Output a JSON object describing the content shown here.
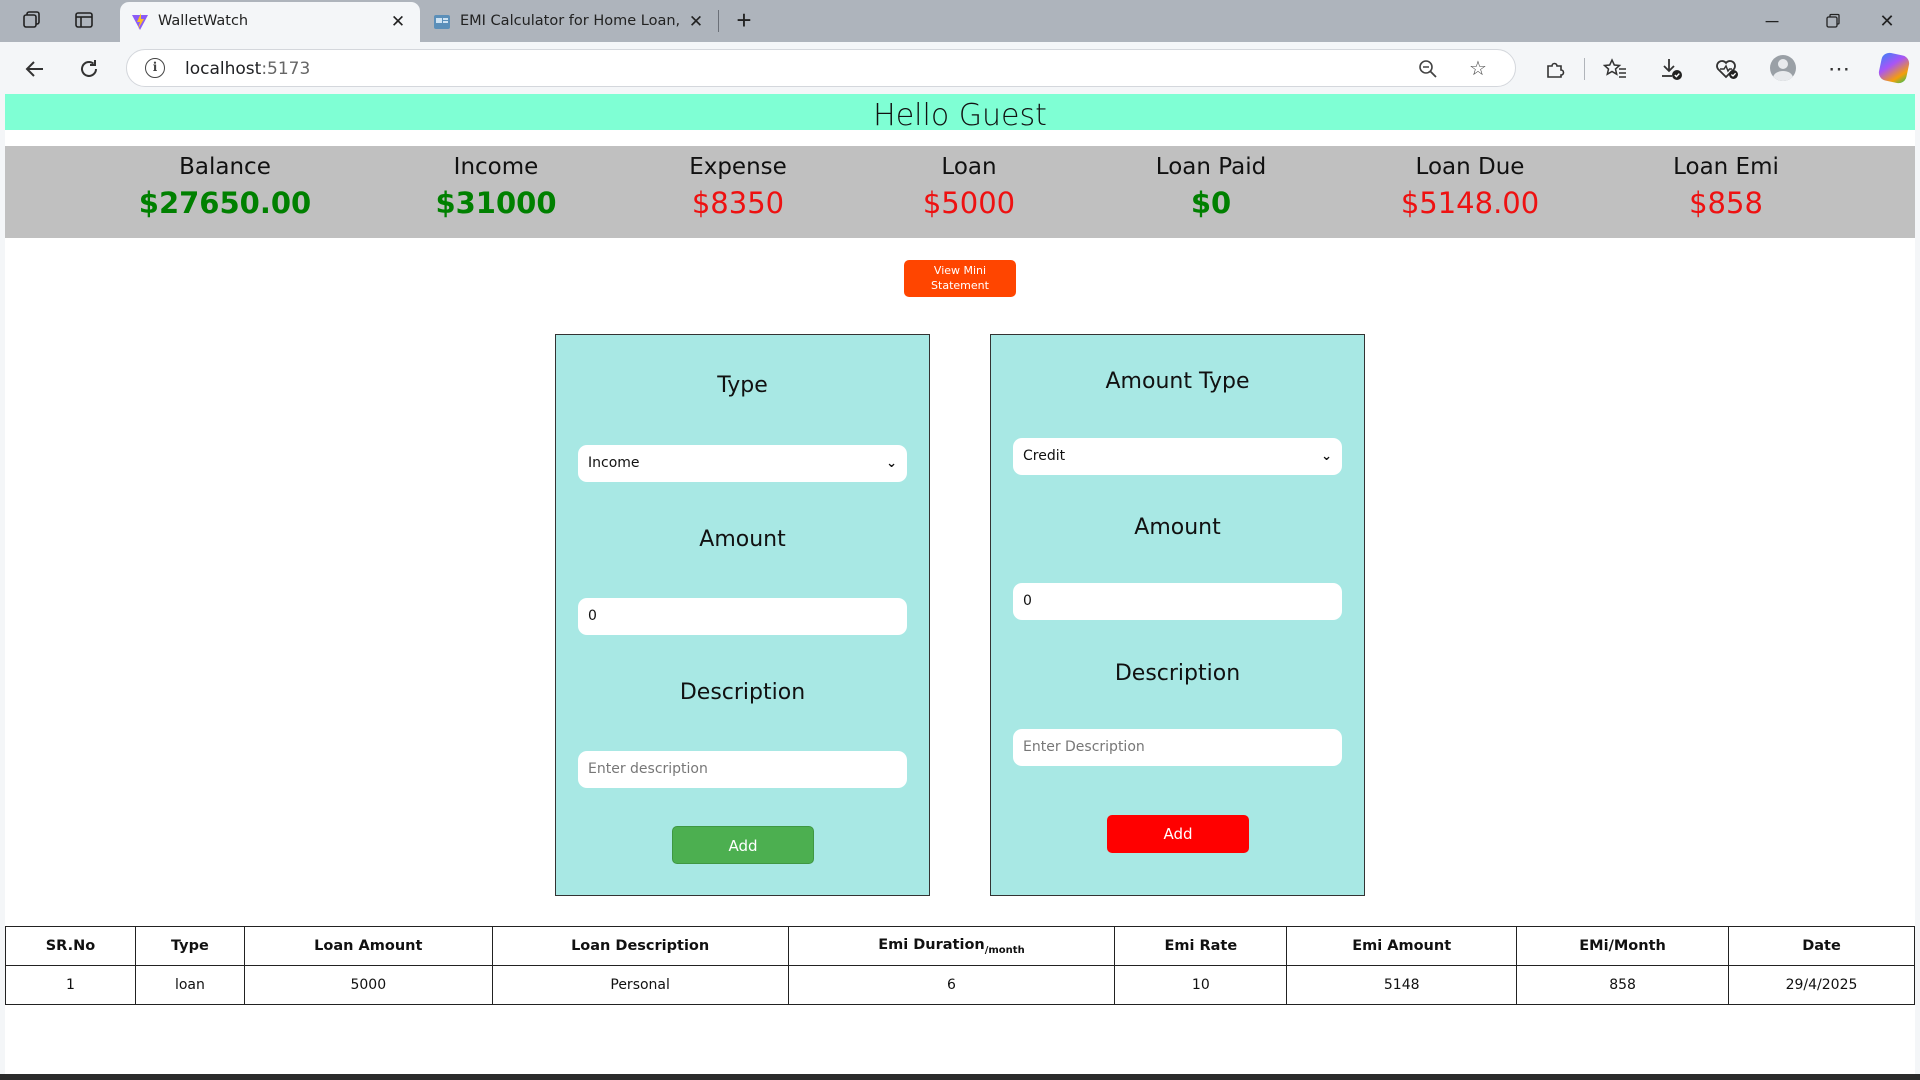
{
  "browser": {
    "tabs": [
      {
        "title": "WalletWatch",
        "active": true,
        "icon": "vite-logo-icon"
      },
      {
        "title": "EMI Calculator for Home Loan, Car Loan",
        "active": false,
        "icon": "page-favicon-icon"
      }
    ],
    "address": {
      "host": "localhost",
      "port": ":5173"
    }
  },
  "page": {
    "greeting": "Hello Guest",
    "summary": [
      {
        "label": "Balance",
        "value": "$27650.00",
        "tone": "green"
      },
      {
        "label": "Income",
        "value": "$31000",
        "tone": "green"
      },
      {
        "label": "Expense",
        "value": "$8350",
        "tone": "red"
      },
      {
        "label": "Loan",
        "value": "$5000",
        "tone": "red"
      },
      {
        "label": "Loan Paid",
        "value": "$0",
        "tone": "green"
      },
      {
        "label": "Loan Due",
        "value": "$5148.00",
        "tone": "red"
      },
      {
        "label": "Loan Emi",
        "value": "$858",
        "tone": "red"
      }
    ],
    "mini_statement_label": "View Mini Statement",
    "entry_form": {
      "type_label": "Type",
      "type_value": "Income",
      "amount_label": "Amount",
      "amount_value": "0",
      "description_label": "Description",
      "description_placeholder": "Enter description",
      "add_label": "Add"
    },
    "loan_form": {
      "type_label": "Amount Type",
      "type_value": "Credit",
      "amount_label": "Amount",
      "amount_value": "0",
      "description_label": "Description",
      "description_placeholder": "Enter Description",
      "add_label": "Add"
    },
    "table": {
      "headers": [
        "SR.No",
        "Type",
        "Loan Amount",
        "Loan Description",
        "Emi Duration",
        "Emi Rate",
        "Emi Amount",
        "EMi/Month",
        "Date"
      ],
      "duration_sub": "/month",
      "rows": [
        [
          "1",
          "loan",
          "5000",
          "Personal",
          "6",
          "10",
          "5148",
          "858",
          "29/4/2025"
        ]
      ]
    }
  },
  "colors": {
    "accent_green": "#008000",
    "accent_red": "#ee1111",
    "header_bg": "#7fffd4",
    "card_bg": "#a8e8e4",
    "mini_btn": "#ff4500"
  }
}
